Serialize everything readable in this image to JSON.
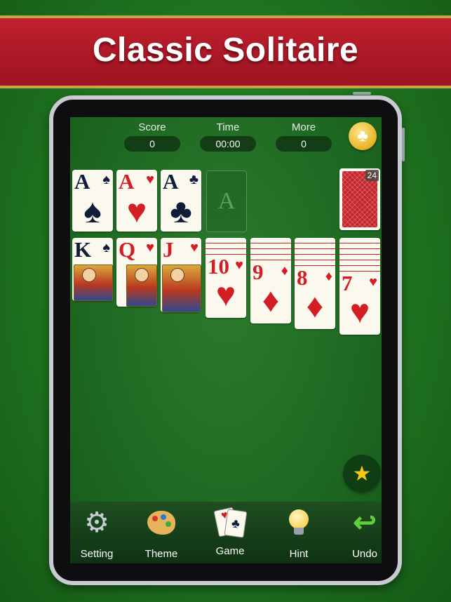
{
  "banner": {
    "title": "Classic Solitaire"
  },
  "header": {
    "score_label": "Score",
    "score_value": "0",
    "time_label": "Time",
    "time_value": "00:00",
    "moves_label": "More",
    "moves_value": "0"
  },
  "foundations": [
    {
      "rank": "A",
      "suit": "♠",
      "color": "black"
    },
    {
      "rank": "A",
      "suit": "♥",
      "color": "red"
    },
    {
      "rank": "A",
      "suit": "♣",
      "color": "black"
    },
    {
      "placeholder": "A"
    }
  ],
  "stock": {
    "count": "24"
  },
  "tableau": [
    {
      "rank": "K",
      "suit": "♠",
      "color": "black"
    },
    {
      "rank": "Q",
      "suit": "♥",
      "color": "red"
    },
    {
      "rank": "J",
      "suit": "♥",
      "color": "red"
    },
    {
      "rank": "10",
      "suit": "♥",
      "color": "red"
    },
    {
      "rank": "9",
      "suit": "♦",
      "color": "red"
    },
    {
      "rank": "8",
      "suit": "♦",
      "color": "red"
    },
    {
      "rank": "7",
      "suit": "♥",
      "color": "red"
    }
  ],
  "toolbar": {
    "setting_label": "Setting",
    "theme_label": "Theme",
    "game_label": "Game",
    "hint_label": "Hint",
    "undo_label": "Undo"
  },
  "colors": {
    "felt": "#227a22",
    "banner_red": "#b01a28",
    "card_red": "#d21f25",
    "card_black": "#0f1d3a"
  },
  "icons": {
    "header": "club-icon",
    "hint_float": "magic-wand-icon",
    "setting": "gear-icon",
    "theme": "palette-icon",
    "game": "cards-icon",
    "hint": "lightbulb-icon",
    "undo": "undo-arrow-icon"
  }
}
